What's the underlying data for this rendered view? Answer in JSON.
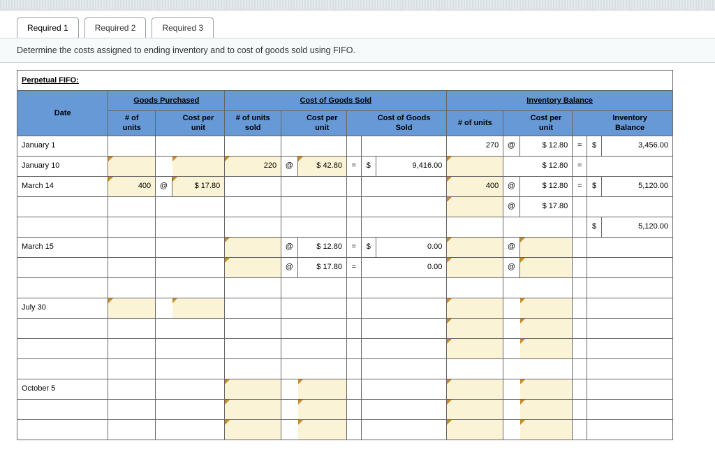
{
  "tabs": {
    "r1": "Required 1",
    "r2": "Required 2",
    "r3": "Required 3"
  },
  "instruction": "Determine the costs assigned to ending inventory and to cost of goods sold using FIFO.",
  "title": "Perpetual FIFO:",
  "sections": {
    "gp": "Goods Purchased",
    "cogs": "Cost of Goods Sold",
    "inv": "Inventory Balance"
  },
  "headers": {
    "date": "Date",
    "gp_units": "# of\nunits",
    "gp_cost": "Cost per\nunit",
    "cogs_units": "# of units\nsold",
    "cogs_cost": "Cost per\nunit",
    "cogs_total": "Cost of Goods\nSold",
    "inv_units": "# of units",
    "inv_cost": "Cost per\nunit",
    "inv_bal": "Inventory\nBalance"
  },
  "sym": {
    "at": "@",
    "eq": "=",
    "dollar": "$"
  },
  "rows": {
    "jan1": {
      "date": "January 1",
      "inv_units": "270",
      "inv_cost": "$ 12.80",
      "inv_bal": "3,456.00"
    },
    "jan10": {
      "date": "January 10",
      "cogs_units": "220",
      "cogs_cost": "$ 42.80",
      "cogs_total": "9,416.00",
      "inv_cost": "$ 12.80"
    },
    "mar14": {
      "date": "March 14",
      "gp_units": "400",
      "gp_cost": "$ 17.80",
      "inv_units": "400",
      "inv_cost": "$ 12.80",
      "inv_bal": "5,120.00"
    },
    "mar14b": {
      "inv_cost": "$ 17.80"
    },
    "mar14t": {
      "inv_bal": "5,120.00"
    },
    "mar15a": {
      "date": "March 15",
      "cogs_cost": "$ 12.80",
      "cogs_total": "0.00"
    },
    "mar15b": {
      "cogs_cost": "$ 17.80",
      "cogs_total": "0.00"
    },
    "jul30": {
      "date": "July 30"
    },
    "oct5": {
      "date": "October 5"
    }
  }
}
